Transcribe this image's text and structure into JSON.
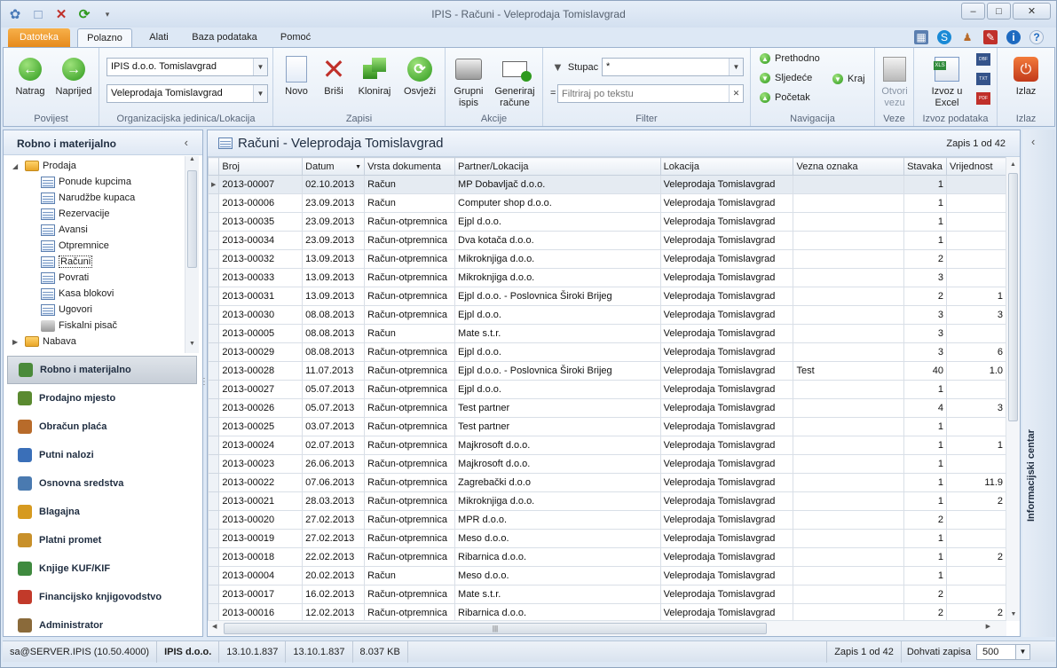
{
  "window": {
    "title": "IPIS - Računi - Veleprodaja Tomislavgrad",
    "min": "–",
    "max": "□",
    "close": "✕"
  },
  "tabs": {
    "file": "Datoteka",
    "items": [
      "Polazno",
      "Alati",
      "Baza podataka",
      "Pomoć"
    ]
  },
  "ribbon": {
    "povijest": {
      "label": "Povijest",
      "back": "Natrag",
      "forward": "Naprijed"
    },
    "org": {
      "label": "Organizacijska jedinica/Lokacija",
      "company": "IPIS d.o.o. Tomislavgrad",
      "location": "Veleprodaja Tomislavgrad"
    },
    "zapisi": {
      "label": "Zapisi",
      "new": "Novo",
      "delete": "Briši",
      "clone": "Kloniraj",
      "refresh": "Osvježi"
    },
    "akcije": {
      "label": "Akcije",
      "print_l1": "Grupni",
      "print_l2": "ispis",
      "gen_l1": "Generiraj",
      "gen_l2": "račune"
    },
    "filter": {
      "label": "Filter",
      "column_label": "Stupac",
      "column_value": "*",
      "eq": "=",
      "placeholder": "Filtriraj po tekstu",
      "clear": "✕"
    },
    "navigacija": {
      "label": "Navigacija",
      "prev": "Prethodno",
      "next": "Sljedeće",
      "first": "Početak",
      "last": "Kraj"
    },
    "veze": {
      "label": "Veze",
      "open_l1": "Otvori",
      "open_l2": "vezu"
    },
    "izvoz": {
      "label": "Izvoz podataka",
      "excel_l1": "Izvoz u",
      "excel_l2": "Excel",
      "f1": "DBF",
      "f2": "TXT",
      "f3": "PDF"
    },
    "izlaz": {
      "label": "Izlaz",
      "exit": "Izlaz"
    }
  },
  "leftpanel": {
    "title": "Robno i materijalno",
    "collapse": "‹",
    "tree": [
      {
        "label": "Prodaja",
        "type": "folder",
        "level": 0,
        "expanded": true
      },
      {
        "label": "Ponude kupcima",
        "type": "doc",
        "level": 1
      },
      {
        "label": "Narudžbe kupaca",
        "type": "doc",
        "level": 1
      },
      {
        "label": "Rezervacije",
        "type": "doc",
        "level": 1
      },
      {
        "label": "Avansi",
        "type": "doc",
        "level": 1
      },
      {
        "label": "Otpremnice",
        "type": "doc",
        "level": 1
      },
      {
        "label": "Računi",
        "type": "doc",
        "level": 1,
        "selected": true
      },
      {
        "label": "Povrati",
        "type": "doc",
        "level": 1
      },
      {
        "label": "Kasa blokovi",
        "type": "doc",
        "level": 1
      },
      {
        "label": "Ugovori",
        "type": "doc",
        "level": 1
      },
      {
        "label": "Fiskalni pisač",
        "type": "printer",
        "level": 1
      },
      {
        "label": "Nabava",
        "type": "folder",
        "level": 0,
        "expanded": false
      }
    ],
    "modules": [
      {
        "label": "Robno i materijalno",
        "active": true,
        "color": "#4a8a3a"
      },
      {
        "label": "Prodajno mjesto",
        "color": "#5a8a30"
      },
      {
        "label": "Obračun plaća",
        "color": "#b86b2a"
      },
      {
        "label": "Putni nalozi",
        "color": "#3a6fb8"
      },
      {
        "label": "Osnovna sredstva",
        "color": "#4a7ab0"
      },
      {
        "label": "Blagajna",
        "color": "#d69a20"
      },
      {
        "label": "Platni promet",
        "color": "#c8902a"
      },
      {
        "label": "Knjige KUF/KIF",
        "color": "#3f8a3f"
      },
      {
        "label": "Financijsko knjigovodstvo",
        "color": "#c23a2a"
      },
      {
        "label": "Administrator",
        "color": "#8a6a3a"
      }
    ]
  },
  "main": {
    "title": "Računi - Veleprodaja Tomislavgrad",
    "record_info": "Zapis 1 od 42",
    "columns": [
      "Broj",
      "Datum",
      "Vrsta dokumenta",
      "Partner/Lokacija",
      "Lokacija",
      "Vezna oznaka",
      "Stavaka",
      "Vrijednost"
    ],
    "sort_indicator": "▼",
    "rows": [
      [
        "2013-00007",
        "02.10.2013",
        "Račun",
        "MP Dobavljač d.o.o.",
        "Veleprodaja Tomislavgrad",
        "",
        "1",
        ""
      ],
      [
        "2013-00006",
        "23.09.2013",
        "Račun",
        "Computer shop d.o.o.",
        "Veleprodaja Tomislavgrad",
        "",
        "1",
        ""
      ],
      [
        "2013-00035",
        "23.09.2013",
        "Račun-otpremnica",
        "Ejpl d.o.o.",
        "Veleprodaja Tomislavgrad",
        "",
        "1",
        ""
      ],
      [
        "2013-00034",
        "23.09.2013",
        "Račun-otpremnica",
        "Dva kotača d.o.o.",
        "Veleprodaja Tomislavgrad",
        "",
        "1",
        ""
      ],
      [
        "2013-00032",
        "13.09.2013",
        "Račun-otpremnica",
        "Mikroknjiga d.o.o.",
        "Veleprodaja Tomislavgrad",
        "",
        "2",
        ""
      ],
      [
        "2013-00033",
        "13.09.2013",
        "Račun-otpremnica",
        "Mikroknjiga d.o.o.",
        "Veleprodaja Tomislavgrad",
        "",
        "3",
        ""
      ],
      [
        "2013-00031",
        "13.09.2013",
        "Račun-otpremnica",
        "Ejpl d.o.o. - Poslovnica Široki Brijeg",
        "Veleprodaja Tomislavgrad",
        "",
        "2",
        "1"
      ],
      [
        "2013-00030",
        "08.08.2013",
        "Račun-otpremnica",
        "Ejpl d.o.o.",
        "Veleprodaja Tomislavgrad",
        "",
        "3",
        "3"
      ],
      [
        "2013-00005",
        "08.08.2013",
        "Račun",
        "Mate s.t.r.",
        "Veleprodaja Tomislavgrad",
        "",
        "3",
        ""
      ],
      [
        "2013-00029",
        "08.08.2013",
        "Račun-otpremnica",
        "Ejpl d.o.o.",
        "Veleprodaja Tomislavgrad",
        "",
        "3",
        "6"
      ],
      [
        "2013-00028",
        "11.07.2013",
        "Račun-otpremnica",
        "Ejpl d.o.o. - Poslovnica Široki Brijeg",
        "Veleprodaja Tomislavgrad",
        "Test",
        "40",
        "1.0"
      ],
      [
        "2013-00027",
        "05.07.2013",
        "Račun-otpremnica",
        "Ejpl d.o.o.",
        "Veleprodaja Tomislavgrad",
        "",
        "1",
        ""
      ],
      [
        "2013-00026",
        "05.07.2013",
        "Račun-otpremnica",
        "Test partner",
        "Veleprodaja Tomislavgrad",
        "",
        "4",
        "3"
      ],
      [
        "2013-00025",
        "03.07.2013",
        "Račun-otpremnica",
        "Test partner",
        "Veleprodaja Tomislavgrad",
        "",
        "1",
        ""
      ],
      [
        "2013-00024",
        "02.07.2013",
        "Račun-otpremnica",
        "Majkrosoft d.o.o.",
        "Veleprodaja Tomislavgrad",
        "",
        "1",
        "1"
      ],
      [
        "2013-00023",
        "26.06.2013",
        "Račun-otpremnica",
        "Majkrosoft d.o.o.",
        "Veleprodaja Tomislavgrad",
        "",
        "1",
        ""
      ],
      [
        "2013-00022",
        "07.06.2013",
        "Račun-otpremnica",
        "Zagrebački d.o.o",
        "Veleprodaja Tomislavgrad",
        "",
        "1",
        "11.9"
      ],
      [
        "2013-00021",
        "28.03.2013",
        "Račun-otpremnica",
        "Mikroknjiga d.o.o.",
        "Veleprodaja Tomislavgrad",
        "",
        "1",
        "2"
      ],
      [
        "2013-00020",
        "27.02.2013",
        "Račun-otpremnica",
        "MPR d.o.o.",
        "Veleprodaja Tomislavgrad",
        "",
        "2",
        ""
      ],
      [
        "2013-00019",
        "27.02.2013",
        "Račun-otpremnica",
        "Meso d.o.o.",
        "Veleprodaja Tomislavgrad",
        "",
        "1",
        ""
      ],
      [
        "2013-00018",
        "22.02.2013",
        "Račun-otpremnica",
        "Ribarnica d.o.o.",
        "Veleprodaja Tomislavgrad",
        "",
        "1",
        "2"
      ],
      [
        "2013-00004",
        "20.02.2013",
        "Račun",
        "Meso d.o.o.",
        "Veleprodaja Tomislavgrad",
        "",
        "1",
        ""
      ],
      [
        "2013-00017",
        "16.02.2013",
        "Račun-otpremnica",
        "Mate s.t.r.",
        "Veleprodaja Tomislavgrad",
        "",
        "2",
        ""
      ],
      [
        "2013-00016",
        "12.02.2013",
        "Račun-otpremnica",
        "Ribarnica d.o.o.",
        "Veleprodaja Tomislavgrad",
        "",
        "2",
        "2"
      ]
    ]
  },
  "rightpanel": {
    "title": "Informacijski centar",
    "collapse": "‹"
  },
  "status": {
    "user": "sa@SERVER.IPIS (10.50.4000)",
    "company": "IPIS d.o.o.",
    "v1": "13.10.1.837",
    "v2": "13.10.1.837",
    "size": "8.037 KB",
    "record": "Zapis 1 od 42",
    "fetch_label": "Dohvati zapisa",
    "fetch_value": "500"
  }
}
